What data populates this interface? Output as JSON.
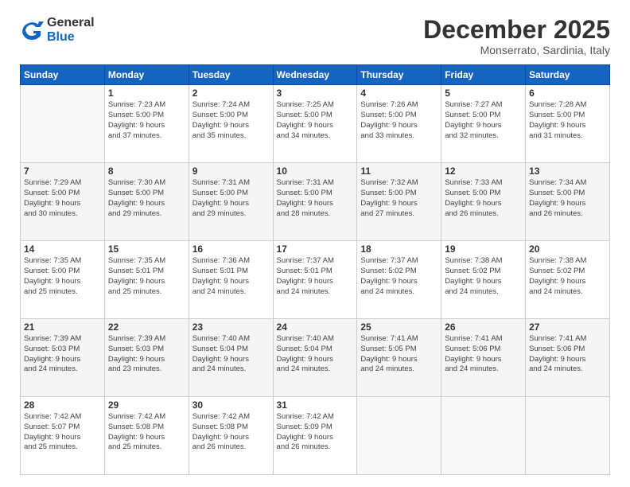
{
  "logo": {
    "general": "General",
    "blue": "Blue"
  },
  "title": "December 2025",
  "location": "Monserrato, Sardinia, Italy",
  "headers": [
    "Sunday",
    "Monday",
    "Tuesday",
    "Wednesday",
    "Thursday",
    "Friday",
    "Saturday"
  ],
  "weeks": [
    [
      {
        "num": "",
        "info": ""
      },
      {
        "num": "1",
        "info": "Sunrise: 7:23 AM\nSunset: 5:00 PM\nDaylight: 9 hours\nand 37 minutes."
      },
      {
        "num": "2",
        "info": "Sunrise: 7:24 AM\nSunset: 5:00 PM\nDaylight: 9 hours\nand 35 minutes."
      },
      {
        "num": "3",
        "info": "Sunrise: 7:25 AM\nSunset: 5:00 PM\nDaylight: 9 hours\nand 34 minutes."
      },
      {
        "num": "4",
        "info": "Sunrise: 7:26 AM\nSunset: 5:00 PM\nDaylight: 9 hours\nand 33 minutes."
      },
      {
        "num": "5",
        "info": "Sunrise: 7:27 AM\nSunset: 5:00 PM\nDaylight: 9 hours\nand 32 minutes."
      },
      {
        "num": "6",
        "info": "Sunrise: 7:28 AM\nSunset: 5:00 PM\nDaylight: 9 hours\nand 31 minutes."
      }
    ],
    [
      {
        "num": "7",
        "info": "Sunrise: 7:29 AM\nSunset: 5:00 PM\nDaylight: 9 hours\nand 30 minutes."
      },
      {
        "num": "8",
        "info": "Sunrise: 7:30 AM\nSunset: 5:00 PM\nDaylight: 9 hours\nand 29 minutes."
      },
      {
        "num": "9",
        "info": "Sunrise: 7:31 AM\nSunset: 5:00 PM\nDaylight: 9 hours\nand 29 minutes."
      },
      {
        "num": "10",
        "info": "Sunrise: 7:31 AM\nSunset: 5:00 PM\nDaylight: 9 hours\nand 28 minutes."
      },
      {
        "num": "11",
        "info": "Sunrise: 7:32 AM\nSunset: 5:00 PM\nDaylight: 9 hours\nand 27 minutes."
      },
      {
        "num": "12",
        "info": "Sunrise: 7:33 AM\nSunset: 5:00 PM\nDaylight: 9 hours\nand 26 minutes."
      },
      {
        "num": "13",
        "info": "Sunrise: 7:34 AM\nSunset: 5:00 PM\nDaylight: 9 hours\nand 26 minutes."
      }
    ],
    [
      {
        "num": "14",
        "info": "Sunrise: 7:35 AM\nSunset: 5:00 PM\nDaylight: 9 hours\nand 25 minutes."
      },
      {
        "num": "15",
        "info": "Sunrise: 7:35 AM\nSunset: 5:01 PM\nDaylight: 9 hours\nand 25 minutes."
      },
      {
        "num": "16",
        "info": "Sunrise: 7:36 AM\nSunset: 5:01 PM\nDaylight: 9 hours\nand 24 minutes."
      },
      {
        "num": "17",
        "info": "Sunrise: 7:37 AM\nSunset: 5:01 PM\nDaylight: 9 hours\nand 24 minutes."
      },
      {
        "num": "18",
        "info": "Sunrise: 7:37 AM\nSunset: 5:02 PM\nDaylight: 9 hours\nand 24 minutes."
      },
      {
        "num": "19",
        "info": "Sunrise: 7:38 AM\nSunset: 5:02 PM\nDaylight: 9 hours\nand 24 minutes."
      },
      {
        "num": "20",
        "info": "Sunrise: 7:38 AM\nSunset: 5:02 PM\nDaylight: 9 hours\nand 24 minutes."
      }
    ],
    [
      {
        "num": "21",
        "info": "Sunrise: 7:39 AM\nSunset: 5:03 PM\nDaylight: 9 hours\nand 24 minutes."
      },
      {
        "num": "22",
        "info": "Sunrise: 7:39 AM\nSunset: 5:03 PM\nDaylight: 9 hours\nand 23 minutes."
      },
      {
        "num": "23",
        "info": "Sunrise: 7:40 AM\nSunset: 5:04 PM\nDaylight: 9 hours\nand 24 minutes."
      },
      {
        "num": "24",
        "info": "Sunrise: 7:40 AM\nSunset: 5:04 PM\nDaylight: 9 hours\nand 24 minutes."
      },
      {
        "num": "25",
        "info": "Sunrise: 7:41 AM\nSunset: 5:05 PM\nDaylight: 9 hours\nand 24 minutes."
      },
      {
        "num": "26",
        "info": "Sunrise: 7:41 AM\nSunset: 5:06 PM\nDaylight: 9 hours\nand 24 minutes."
      },
      {
        "num": "27",
        "info": "Sunrise: 7:41 AM\nSunset: 5:06 PM\nDaylight: 9 hours\nand 24 minutes."
      }
    ],
    [
      {
        "num": "28",
        "info": "Sunrise: 7:42 AM\nSunset: 5:07 PM\nDaylight: 9 hours\nand 25 minutes."
      },
      {
        "num": "29",
        "info": "Sunrise: 7:42 AM\nSunset: 5:08 PM\nDaylight: 9 hours\nand 25 minutes."
      },
      {
        "num": "30",
        "info": "Sunrise: 7:42 AM\nSunset: 5:08 PM\nDaylight: 9 hours\nand 26 minutes."
      },
      {
        "num": "31",
        "info": "Sunrise: 7:42 AM\nSunset: 5:09 PM\nDaylight: 9 hours\nand 26 minutes."
      },
      {
        "num": "",
        "info": ""
      },
      {
        "num": "",
        "info": ""
      },
      {
        "num": "",
        "info": ""
      }
    ]
  ]
}
